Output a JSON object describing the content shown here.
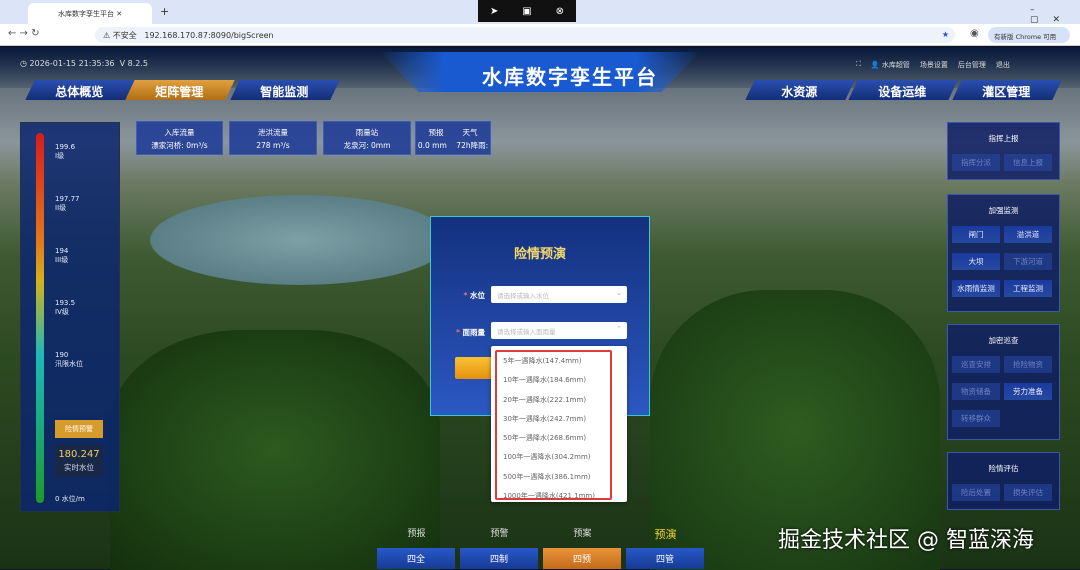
{
  "browser": {
    "tab_title": "水库数字孪生平台",
    "new_tab": "+",
    "security": "不安全",
    "url": "192.168.170.87:8090/bigScreen",
    "update": "有新版 Chrome 可用"
  },
  "header": {
    "datetime": "2026-01-15 21:35:36",
    "version": "V 8.2.5",
    "title": "水库数字孪生平台",
    "user": "水库超管",
    "links": [
      "场景设置",
      "后台管理",
      "退出"
    ]
  },
  "nav_left": [
    "总体概览",
    "矩阵管理",
    "智能监测"
  ],
  "nav_right": [
    "水资源",
    "设备运维",
    "灌区管理"
  ],
  "info_cards": [
    {
      "title": "入库流量",
      "value": "漂家河桥:   0m³/s"
    },
    {
      "title": "泄洪流量",
      "value": "278 m³/s"
    },
    {
      "title": "雨量站",
      "value": "龙泉河:  0mm"
    },
    {
      "title": "预报        天气",
      "value": "0.0 mm    72h降雨:"
    }
  ],
  "gauge": {
    "levels": [
      {
        "value": "199.6",
        "label": "I级"
      },
      {
        "value": "197.77",
        "label": "II级"
      },
      {
        "value": "194",
        "label": "III级"
      },
      {
        "value": "193.5",
        "label": "IV级"
      },
      {
        "value": "190",
        "label": "汛限水位"
      }
    ],
    "warn_button": "险情预警",
    "current_value": "180.247",
    "current_label": "实时水位",
    "axis": "0 水位/m"
  },
  "right_panels": [
    {
      "title": "指挥上报",
      "buttons": [
        {
          "label": "指挥分派",
          "active": false
        },
        {
          "label": "信息上报",
          "active": false
        }
      ]
    },
    {
      "title": "加强监测",
      "buttons": [
        {
          "label": "闸门",
          "active": true
        },
        {
          "label": "溢洪道",
          "active": true
        },
        {
          "label": "大坝",
          "active": true
        },
        {
          "label": "下游河道",
          "active": false
        },
        {
          "label": "水雨情监测",
          "active": true
        },
        {
          "label": "工程监测",
          "active": true
        }
      ]
    },
    {
      "title": "加密巡查",
      "buttons": [
        {
          "label": "巡查安排",
          "active": false
        },
        {
          "label": "抢险物资",
          "active": false
        },
        {
          "label": "物资储备",
          "active": false
        },
        {
          "label": "劳力准备",
          "active": true
        },
        {
          "label": "转移群众",
          "active": false
        }
      ]
    },
    {
      "title": "险情评估",
      "buttons": [
        {
          "label": "险后处置",
          "active": false
        },
        {
          "label": "损失评估",
          "active": false
        }
      ]
    }
  ],
  "modal": {
    "title": "险情预演",
    "field1_label": "水位",
    "field1_placeholder": "请选择或输入水位",
    "field2_label": "面雨量",
    "field2_placeholder": "请选择或输入面雨量",
    "options": [
      "5年一遇降水(147.4mm)",
      "10年一遇降水(184.6mm)",
      "20年一遇降水(222.1mm)",
      "30年一遇降水(242.7mm)",
      "50年一遇降水(268.6mm)",
      "100年一遇降水(304.2mm)",
      "500年一遇降水(386.1mm)",
      "1000年一遇降水(421.1mm)"
    ]
  },
  "bottom": {
    "tabs": [
      "预报",
      "预警",
      "预案",
      "预演"
    ],
    "active_tab": 3,
    "buttons": [
      "四全",
      "四制",
      "四预",
      "四管"
    ],
    "active_button": 2
  },
  "watermark": "掘金技术社区 @ 智蓝深海"
}
